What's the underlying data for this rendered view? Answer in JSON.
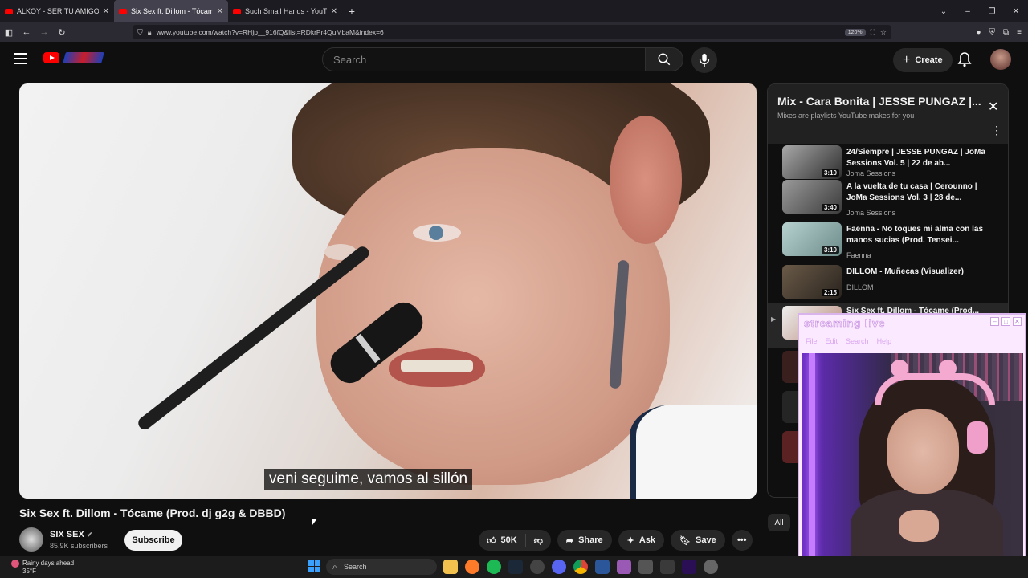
{
  "browser": {
    "tabs": [
      {
        "title": "ALKOY - SER TU AMIGO NO ES"
      },
      {
        "title": "Six Sex ft. Dillom - Tócame (Pro"
      },
      {
        "title": "Such Small Hands - YouTube"
      }
    ],
    "url": "www.youtube.com/watch?v=RHjp__916fQ&list=RDkrPr4QuMbaM&index=6",
    "zoom": "120%"
  },
  "header": {
    "search_placeholder": "Search",
    "create_label": "Create"
  },
  "video": {
    "caption": "veni seguime, vamos al sillón",
    "title": "Six Sex ft. Dillom - Tócame (Prod. dj g2g & DBBD)",
    "channel": "SIX SEX",
    "subscribers": "85.9K subscribers",
    "subscribe_label": "Subscribe",
    "likes": "50K",
    "share_label": "Share",
    "ask_label": "Ask",
    "save_label": "Save"
  },
  "playlist": {
    "title": "Mix - Cara Bonita | JESSE PUNGAZ |...",
    "subtitle": "Mixes are playlists YouTube makes for you",
    "items": [
      {
        "title": "24/Siempre | JESSE PUNGAZ | JoMa Sessions Vol. 5 | 22 de ab...",
        "channel": "Joma Sessions",
        "duration": "3:10"
      },
      {
        "title": "A la vuelta de tu casa | Cerounno | JoMa Sessions Vol. 3 | 28 de...",
        "channel": "Joma Sessions",
        "duration": "3:40"
      },
      {
        "title": "Faenna - No toques mi alma con las manos sucias (Prod. Tensei...",
        "channel": "Faenna",
        "duration": "3:10"
      },
      {
        "title": "DILLOM - Muñecas (Visualizer)",
        "channel": "DILLOM",
        "duration": "2:15"
      },
      {
        "title": "Six Sex ft. Dillom - Tócame (Prod...",
        "channel": "",
        "duration": ""
      }
    ]
  },
  "chips": {
    "all": "All"
  },
  "stream_overlay": {
    "title": "streaming live",
    "menu": [
      "File",
      "Edit",
      "Search",
      "Help"
    ]
  },
  "taskbar": {
    "weather_title": "Rainy days ahead",
    "weather_temp": "35°F",
    "search_label": "Search"
  },
  "colors": {
    "yt_red": "#ff0000",
    "background": "#0f0f0f",
    "stream_accent": "#d9b4ec"
  }
}
